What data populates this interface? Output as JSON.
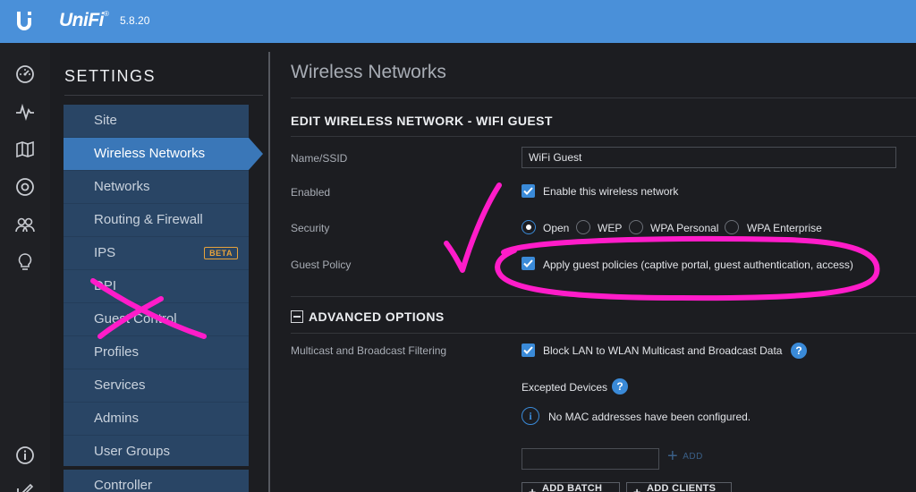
{
  "app": {
    "brand": "UniFi",
    "trademark": "®",
    "version": "5.8.20"
  },
  "rail_icons": [
    "dashboard-icon",
    "statistics-icon",
    "map-icon",
    "devices-icon",
    "clients-icon",
    "insights-icon",
    "about-icon",
    "edit-icon"
  ],
  "settings": {
    "title": "SETTINGS",
    "items": [
      {
        "label": "Site"
      },
      {
        "label": "Wireless Networks"
      },
      {
        "label": "Networks"
      },
      {
        "label": "Routing & Firewall"
      },
      {
        "label": "IPS",
        "badge": "BETA"
      },
      {
        "label": "DPI"
      },
      {
        "label": "Guest Control"
      },
      {
        "label": "Profiles"
      },
      {
        "label": "Services"
      },
      {
        "label": "Admins"
      },
      {
        "label": "User Groups"
      },
      {
        "label": "Controller"
      }
    ],
    "active_index": 1
  },
  "main": {
    "page_title": "Wireless Networks",
    "section_title": "EDIT WIRELESS NETWORK - WIFI GUEST",
    "name": {
      "label": "Name/SSID",
      "value": "WiFi Guest"
    },
    "enabled": {
      "label": "Enabled",
      "option": "Enable this wireless network",
      "checked": true
    },
    "security": {
      "label": "Security",
      "options": [
        "Open",
        "WEP",
        "WPA Personal",
        "WPA Enterprise"
      ],
      "selected": "Open"
    },
    "guest_policy": {
      "label": "Guest Policy",
      "option": "Apply guest policies (captive portal, guest authentication, access)",
      "checked": true
    },
    "advanced": {
      "title": "ADVANCED OPTIONS",
      "multicast": {
        "label": "Multicast and Broadcast Filtering",
        "option": "Block LAN to WLAN Multicast and Broadcast Data",
        "checked": true
      },
      "excepted_label": "Excepted Devices",
      "no_mac": "No MAC addresses have been configured.",
      "mac_input_value": "",
      "add_label": "ADD",
      "add_batch": "ADD BATCH",
      "add_clients": "ADD CLIENTS"
    }
  },
  "colors": {
    "topbar": "#4a90d9",
    "accent": "#3a8ad8",
    "menu_bg": "#294565",
    "menu_active": "#3a77b8",
    "beta": "#e8a33b",
    "annotation": "#ff1cc9"
  }
}
